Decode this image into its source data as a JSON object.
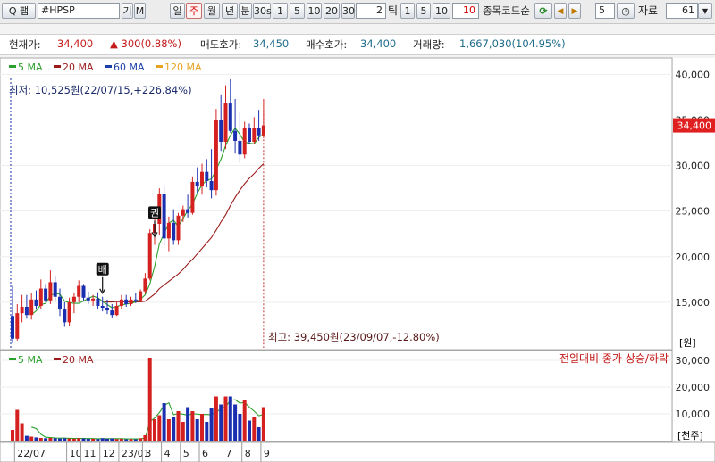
{
  "toolbar": {
    "search_button_label": "Q 팹",
    "symbol_value": "#HPSP",
    "btn_gi": "기",
    "btn_m": "M",
    "period_buttons": [
      "일",
      "주",
      "월",
      "년",
      "분",
      "30s",
      "1",
      "5",
      "10",
      "20",
      "30"
    ],
    "active_period": "주",
    "tick_input": "2",
    "tick_label": "틱",
    "tick_buttons": [
      "1",
      "5",
      "10"
    ],
    "tick_value": "10",
    "stock_code_label": "종목코드순",
    "count_value": "5",
    "data_label": "자료",
    "data_value": "61"
  },
  "info": {
    "price_label": "현재가:",
    "price_value": "34,400",
    "change_value": "▲ 300(0.88%)",
    "ask_label": "매도호가:",
    "ask_value": "34,450",
    "bid_label": "매수호가:",
    "bid_value": "34,400",
    "volume_label": "거래량:",
    "volume_value": "1,667,030(104.95%)"
  },
  "colors": {
    "up": "#d4211f",
    "down": "#1a2fb0",
    "ma5": "#2ca02c",
    "ma20": "#9b1b1b",
    "ma60": "#1d3fa8",
    "ma120": "#e6a323",
    "price_tag_bg": "#e02020"
  },
  "chart_data": {
    "type": "candlestick",
    "legend": [
      {
        "name": "5 MA",
        "color": "#2ca02c"
      },
      {
        "name": "20 MA",
        "color": "#9b1b1b"
      },
      {
        "name": "60 MA",
        "color": "#1d3fa8"
      },
      {
        "name": "120 MA",
        "color": "#e6a323"
      }
    ],
    "y_ticks": [
      "40,000",
      "35,000",
      "30,000",
      "25,000",
      "20,000",
      "15,000"
    ],
    "y_unit": "[원]",
    "ylim": [
      10000,
      41500
    ],
    "current_price": "34,400",
    "current_price_value": 34400,
    "min_annotation": "최저: 10,525원(22/07/15,+226.84%)",
    "max_annotation": "최고: 39,450원(23/09/07,-12.80%)",
    "markers": [
      {
        "text": "배",
        "index": 19,
        "value": 15600
      },
      {
        "text": "권",
        "index": 30,
        "value": 21800
      }
    ],
    "x_labels": [
      {
        "text": "22/07",
        "index": 1
      },
      {
        "text": "10",
        "index": 12
      },
      {
        "text": "11",
        "index": 15
      },
      {
        "text": "12",
        "index": 19
      },
      {
        "text": "23/01",
        "index": 23
      },
      {
        "text": "3",
        "index": 28
      },
      {
        "text": "4",
        "index": 32
      },
      {
        "text": "5",
        "index": 36
      },
      {
        "text": "6",
        "index": 40
      },
      {
        "text": "7",
        "index": 45
      },
      {
        "text": "8",
        "index": 49
      },
      {
        "text": "9",
        "index": 53
      }
    ],
    "candles": [
      [
        13500,
        16800,
        10525,
        11000
      ],
      [
        11000,
        14800,
        10800,
        13800
      ],
      [
        13800,
        15800,
        12800,
        14500
      ],
      [
        14500,
        15800,
        13200,
        13600
      ],
      [
        13600,
        16000,
        13100,
        15300
      ],
      [
        15300,
        16300,
        14300,
        14600
      ],
      [
        14600,
        17500,
        14200,
        16500
      ],
      [
        16500,
        17000,
        15000,
        15200
      ],
      [
        15200,
        18500,
        14800,
        17200
      ],
      [
        17200,
        17800,
        15100,
        15600
      ],
      [
        15600,
        16500,
        13500,
        14200
      ],
      [
        14200,
        15000,
        12300,
        12800
      ],
      [
        12800,
        15500,
        12400,
        15000
      ],
      [
        15000,
        16000,
        13800,
        15600
      ],
      [
        15600,
        17400,
        15000,
        16800
      ],
      [
        16800,
        17000,
        15200,
        15500
      ],
      [
        15500,
        16200,
        14800,
        15200
      ],
      [
        15200,
        15800,
        14600,
        15400
      ],
      [
        15400,
        16100,
        14300,
        14600
      ],
      [
        14600,
        15600,
        14000,
        14400
      ],
      [
        14400,
        15300,
        13700,
        14100
      ],
      [
        14100,
        14800,
        13300,
        13600
      ],
      [
        13600,
        15000,
        13500,
        14600
      ],
      [
        14600,
        15800,
        14300,
        15300
      ],
      [
        15300,
        15800,
        14500,
        14800
      ],
      [
        14800,
        15600,
        14600,
        15300
      ],
      [
        15300,
        16000,
        14900,
        15200
      ],
      [
        15200,
        16400,
        15000,
        16200
      ],
      [
        16200,
        18200,
        15900,
        17600
      ],
      [
        17600,
        23000,
        17400,
        22600
      ],
      [
        22600,
        24200,
        21300,
        23600
      ],
      [
        23600,
        27500,
        22400,
        26900
      ],
      [
        26900,
        27800,
        21200,
        22000
      ],
      [
        22000,
        24400,
        20600,
        23700
      ],
      [
        23700,
        25200,
        21300,
        21800
      ],
      [
        21800,
        24800,
        21300,
        24500
      ],
      [
        24500,
        25600,
        23800,
        25200
      ],
      [
        25200,
        26800,
        24300,
        24800
      ],
      [
        24800,
        28800,
        24600,
        28200
      ],
      [
        28200,
        29800,
        27000,
        27700
      ],
      [
        27700,
        30200,
        26800,
        29300
      ],
      [
        29300,
        30700,
        27600,
        28300
      ],
      [
        28300,
        31800,
        26400,
        27300
      ],
      [
        27300,
        36200,
        26700,
        35000
      ],
      [
        35000,
        37800,
        31600,
        32600
      ],
      [
        32600,
        38800,
        31800,
        36800
      ],
      [
        36800,
        39450,
        33600,
        33800
      ],
      [
        33800,
        37300,
        31300,
        32700
      ],
      [
        32700,
        35800,
        30300,
        31200
      ],
      [
        31200,
        34800,
        30800,
        34100
      ],
      [
        34100,
        34600,
        32300,
        32600
      ],
      [
        32600,
        35300,
        32400,
        34100
      ],
      [
        34100,
        36100,
        32700,
        33300
      ],
      [
        33300,
        37300,
        33000,
        34400
      ]
    ],
    "ma5": [
      null,
      null,
      null,
      null,
      13640,
      14060,
      14740,
      14880,
      15720,
      15980,
      15880,
      15120,
      14960,
      14880,
      14880,
      15140,
      15420,
      15660,
      15500,
      15100,
      14740,
      14400,
      14540,
      14680,
      14820,
      14840,
      15060,
      15320,
      15820,
      17020,
      18920,
      21400,
      22540,
      23700,
      24000,
      23280,
      24180,
      25060,
      25760,
      26940,
      27900,
      28360,
      28520,
      29540,
      30680,
      32200,
      33300,
      34100,
      33420,
      32540,
      32440,
      32360,
      33100,
      33400
    ],
    "ma20": [
      null,
      null,
      null,
      null,
      null,
      null,
      null,
      null,
      null,
      null,
      null,
      null,
      null,
      null,
      null,
      null,
      null,
      null,
      null,
      15000,
      15050,
      15030,
      15080,
      15070,
      15040,
      15030,
      15050,
      15050,
      15120,
      15500,
      15900,
      16500,
      16900,
      17300,
      17700,
      18100,
      18600,
      19200,
      19700,
      20300,
      20900,
      21500,
      22100,
      22900,
      23800,
      24600,
      25600,
      26500,
      27300,
      28000,
      28600,
      29100,
      29700,
      30200
    ],
    "volume": [
      {
        "v": 4000,
        "up": true
      },
      {
        "v": 11500,
        "up": true
      },
      {
        "v": 6500,
        "up": true
      },
      {
        "v": 1800,
        "up": false
      },
      {
        "v": 1500,
        "up": true
      },
      {
        "v": 1200,
        "up": false
      },
      {
        "v": 1000,
        "up": true
      },
      {
        "v": 900,
        "up": false
      },
      {
        "v": 1000,
        "up": true
      },
      {
        "v": 900,
        "up": false
      },
      {
        "v": 800,
        "up": false
      },
      {
        "v": 900,
        "up": false
      },
      {
        "v": 800,
        "up": true
      },
      {
        "v": 700,
        "up": true
      },
      {
        "v": 900,
        "up": true
      },
      {
        "v": 800,
        "up": false
      },
      {
        "v": 700,
        "up": false
      },
      {
        "v": 700,
        "up": true
      },
      {
        "v": 600,
        "up": false
      },
      {
        "v": 900,
        "up": false
      },
      {
        "v": 700,
        "up": false
      },
      {
        "v": 800,
        "up": false
      },
      {
        "v": 600,
        "up": true
      },
      {
        "v": 700,
        "up": true
      },
      {
        "v": 500,
        "up": false
      },
      {
        "v": 600,
        "up": true
      },
      {
        "v": 500,
        "up": false
      },
      {
        "v": 900,
        "up": true
      },
      {
        "v": 2000,
        "up": true
      },
      {
        "v": 31000,
        "up": true
      },
      {
        "v": 8000,
        "up": true
      },
      {
        "v": 9500,
        "up": true
      },
      {
        "v": 14000,
        "up": false
      },
      {
        "v": 8000,
        "up": true
      },
      {
        "v": 9000,
        "up": false
      },
      {
        "v": 11000,
        "up": true
      },
      {
        "v": 7000,
        "up": true
      },
      {
        "v": 12500,
        "up": false
      },
      {
        "v": 11000,
        "up": true
      },
      {
        "v": 8000,
        "up": false
      },
      {
        "v": 10000,
        "up": true
      },
      {
        "v": 7000,
        "up": false
      },
      {
        "v": 12000,
        "up": false
      },
      {
        "v": 16500,
        "up": true
      },
      {
        "v": 13500,
        "up": false
      },
      {
        "v": 16500,
        "up": true
      },
      {
        "v": 16500,
        "up": false
      },
      {
        "v": 13500,
        "up": false
      },
      {
        "v": 10000,
        "up": false
      },
      {
        "v": 15000,
        "up": true
      },
      {
        "v": 7500,
        "up": false
      },
      {
        "v": 9000,
        "up": true
      },
      {
        "v": 5000,
        "up": false
      },
      {
        "v": 12500,
        "up": true
      }
    ],
    "vol_ma5": [
      null,
      null,
      null,
      null,
      5060,
      4500,
      2400,
      1280,
      1120,
      1000,
      920,
      920,
      880,
      820,
      820,
      820,
      780,
      760,
      700,
      740,
      720,
      740,
      720,
      740,
      660,
      680,
      640,
      660,
      940,
      7000,
      8480,
      10480,
      13100,
      14100,
      9700,
      10100,
      9900,
      9500,
      10100,
      9900,
      9700,
      9800,
      9600,
      10700,
      11800,
      12700,
      15000,
      15300,
      14000,
      14300,
      12500,
      11000,
      9300,
      9800
    ],
    "volume_legend": [
      {
        "name": "5 MA",
        "color": "#2ca02c"
      },
      {
        "name": "20 MA",
        "color": "#9b1b1b"
      }
    ],
    "volume_title": "전일대비 종가 상승/하락",
    "vol_ticks": [
      "30,000",
      "20,000",
      "10,000"
    ],
    "vol_unit": "[천주]",
    "vol_max": 32000
  }
}
